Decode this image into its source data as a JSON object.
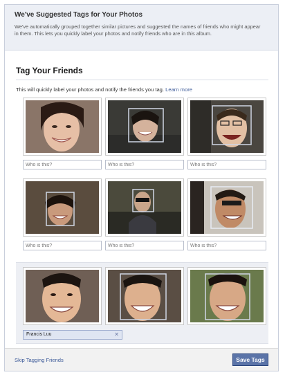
{
  "notice": {
    "title": "We've Suggested Tags for Your Photos",
    "body": "We've automatically grouped together similar pictures and suggested the names of friends who might appear in them. This lets you quickly label your photos and notify friends who are in this album."
  },
  "section": {
    "title": "Tag Your Friends",
    "description": "This will quickly label your photos and notify the friends you tag.",
    "learn_more": "Learn more"
  },
  "photos": {
    "placeholder": "Who is this?",
    "row1": [
      "Who is this?",
      "Who is this?",
      "Who is this?"
    ],
    "row2": [
      "Who is this?",
      "Who is this?",
      "Who is this?"
    ]
  },
  "group": {
    "tag_name": "Francis Luu",
    "remove_icon": "close-icon"
  },
  "footer": {
    "skip_label": "Skip Tagging Friends",
    "save_label": "Save Tags"
  },
  "colors": {
    "accent": "#3b5998",
    "button": "#5b74a8",
    "notice_bg": "#eceff5"
  }
}
